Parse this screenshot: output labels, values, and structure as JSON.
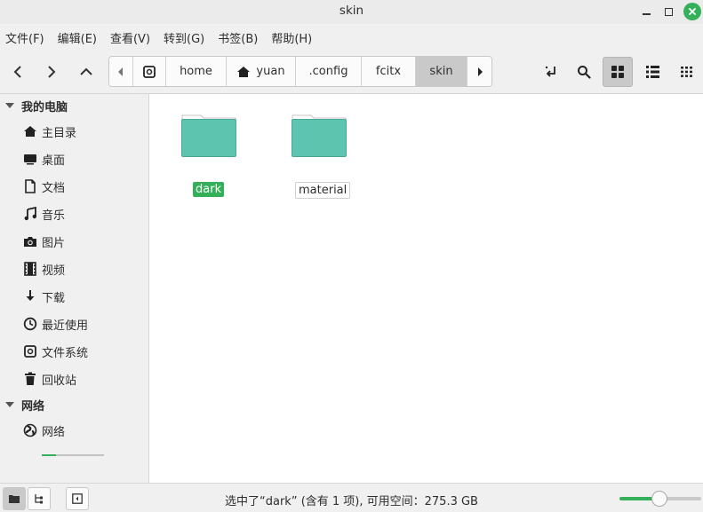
{
  "window": {
    "title": "skin"
  },
  "menu": [
    {
      "label": "文件(F)"
    },
    {
      "label": "编辑(E)"
    },
    {
      "label": "查看(V)"
    },
    {
      "label": "转到(G)"
    },
    {
      "label": "书签(B)"
    },
    {
      "label": "帮助(H)"
    }
  ],
  "pathbar": {
    "crumbs": [
      {
        "label": "home",
        "icon": "drive-icon"
      },
      {
        "label": "yuan",
        "icon": "home-icon"
      },
      {
        "label": ".config"
      },
      {
        "label": "fcitx"
      },
      {
        "label": "skin",
        "active": true
      }
    ]
  },
  "sidebar": {
    "sections": [
      {
        "title": "我的电脑",
        "items": [
          {
            "label": "主目录",
            "icon": "home-icon"
          },
          {
            "label": "桌面",
            "icon": "desktop-icon"
          },
          {
            "label": "文档",
            "icon": "document-icon"
          },
          {
            "label": "音乐",
            "icon": "music-icon"
          },
          {
            "label": "图片",
            "icon": "camera-icon"
          },
          {
            "label": "视频",
            "icon": "film-icon"
          },
          {
            "label": "下载",
            "icon": "download-icon"
          },
          {
            "label": "最近使用",
            "icon": "clock-icon"
          },
          {
            "label": "文件系统",
            "icon": "drive-icon"
          },
          {
            "label": "回收站",
            "icon": "trash-icon"
          }
        ]
      },
      {
        "title": "网络",
        "items": [
          {
            "label": "网络",
            "icon": "globe-icon"
          }
        ]
      }
    ]
  },
  "files": [
    {
      "name": "dark",
      "selected": true
    },
    {
      "name": "material",
      "selected": false
    }
  ],
  "status": {
    "text": "选中了“dark” (含有 1 项), 可用空间：275.3 GB",
    "zoom": 0.45
  },
  "colors": {
    "accent": "#35b05a",
    "folder": "#5cc4af"
  }
}
